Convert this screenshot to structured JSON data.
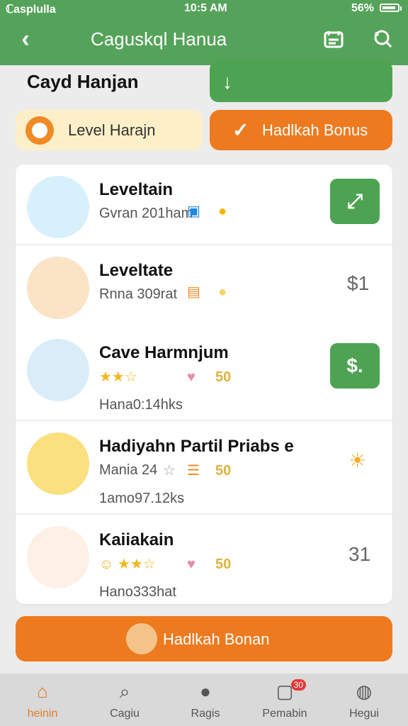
{
  "status": {
    "left": "ℂasplulla",
    "time": "10:5 AM",
    "right": "56%"
  },
  "header": {
    "title": "Caguskql Hanua"
  },
  "section": {
    "title": "Cayd Hanjan",
    "level_label": "Level Harajn",
    "bonus_label": "Hadlkah Bonus"
  },
  "items": [
    {
      "title": "Leveltain",
      "sub": "Gvran 201ham",
      "price": ""
    },
    {
      "title": "Leveltate",
      "sub": "Rnna 309rat",
      "price": "$1"
    },
    {
      "title": "Cave Harmnjum",
      "sub2": "Hana0:14hks",
      "stars": "★★☆",
      "count": "50",
      "price": "$."
    },
    {
      "title": "Hadiyahn Partil Priabs e",
      "sub": "Mania 24",
      "sub2": "1amo97.12ks",
      "count": "50",
      "price": ""
    },
    {
      "title": "Kaiiakain",
      "sub2": "Hano333hat",
      "count": "50",
      "price": "31"
    }
  ],
  "bottom_cta": {
    "label": "Hadlkah Bonan"
  },
  "nav": {
    "items": [
      {
        "label": "heinin",
        "icon": "home-icon"
      },
      {
        "label": "Cagiu",
        "icon": "search-icon"
      },
      {
        "label": "Ragis",
        "icon": "chat-icon"
      },
      {
        "label": "Pemabin",
        "icon": "inbox-icon",
        "badge": "30"
      },
      {
        "label": "Hegui",
        "icon": "profile-icon"
      }
    ]
  },
  "colors": {
    "green": "#4da352",
    "orange": "#ee7a1f",
    "cream": "#fdf0c9"
  }
}
